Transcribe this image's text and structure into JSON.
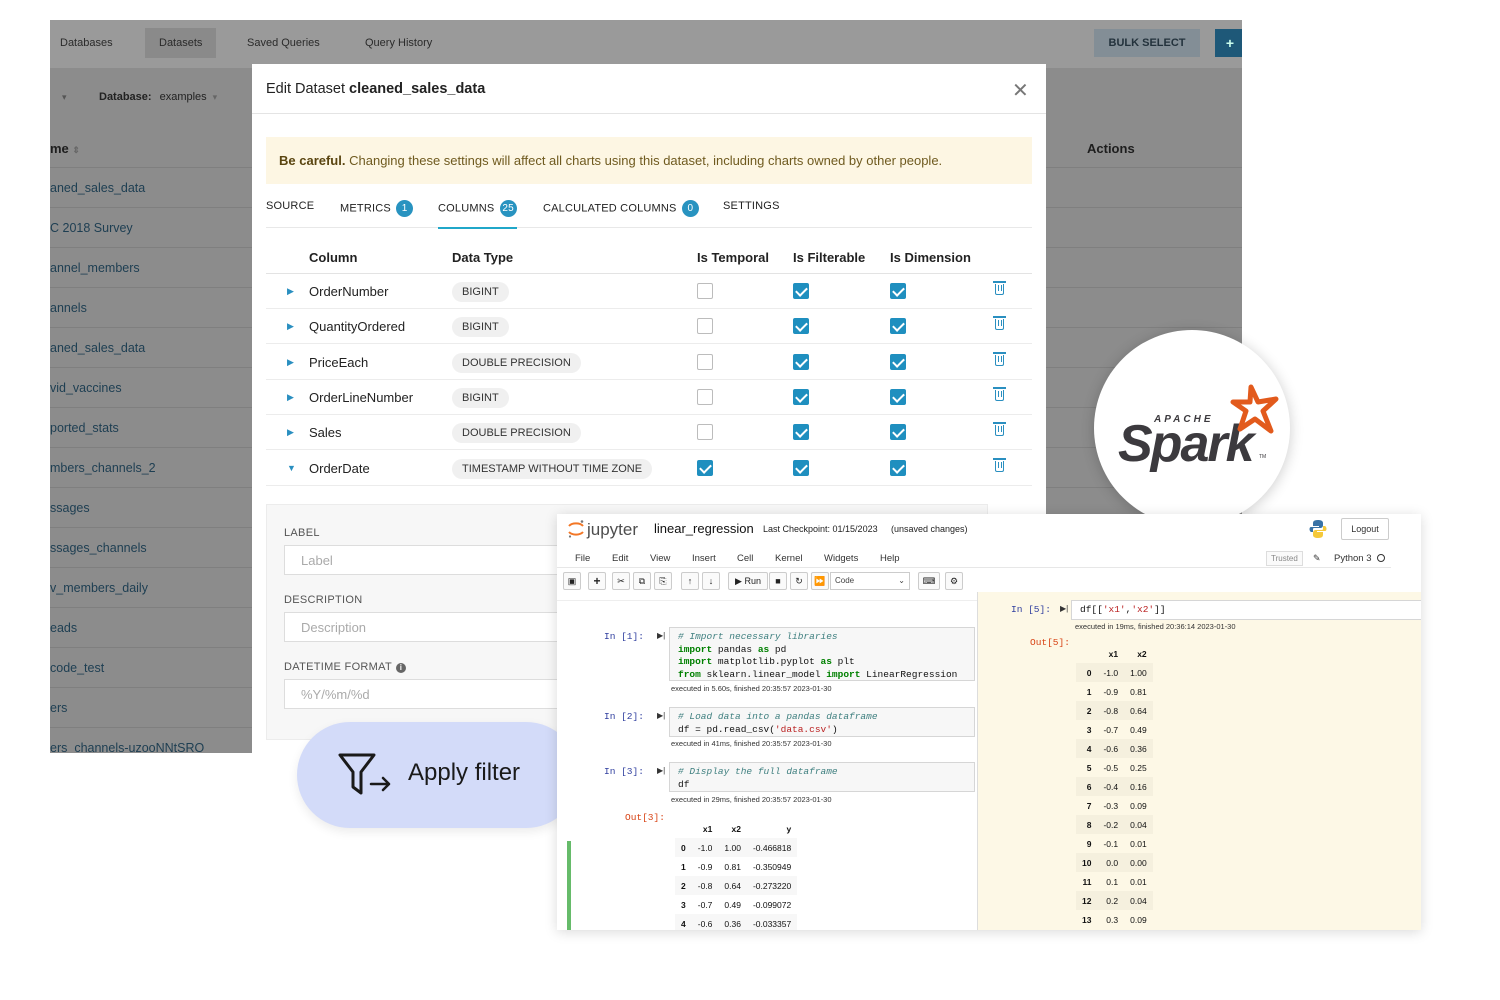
{
  "background_app": {
    "nav": [
      "Databases",
      "Datasets",
      "Saved Queries",
      "Query History"
    ],
    "bulk_select": "BULK SELECT",
    "add_button": "+",
    "database_filter_label": "Database:",
    "database_filter_value": "examples",
    "name_column": "me",
    "actions_column": "Actions",
    "rows": [
      "aned_sales_data",
      "C 2018 Survey",
      "annel_members",
      "annels",
      "aned_sales_data",
      "vid_vaccines",
      "ported_stats",
      "mbers_channels_2",
      "ssages",
      "ssages_channels",
      "v_members_daily",
      "eads",
      "code_test",
      "ers",
      "ers_channels-uzooNNtSRO"
    ]
  },
  "modal": {
    "title_prefix": "Edit Dataset",
    "title_dataset": "cleaned_sales_data",
    "warning_bold": "Be careful.",
    "warning_text": "Changing these settings will affect all charts using this dataset, including charts owned by other people.",
    "tabs": [
      {
        "label": "SOURCE",
        "count": null
      },
      {
        "label": "METRICS",
        "count": "1"
      },
      {
        "label": "COLUMNS",
        "count": "25"
      },
      {
        "label": "CALCULATED COLUMNS",
        "count": "0"
      },
      {
        "label": "SETTINGS",
        "count": null
      }
    ],
    "active_tab": "COLUMNS",
    "headers": [
      "Column",
      "Data Type",
      "Is Temporal",
      "Is Filterable",
      "Is Dimension"
    ],
    "columns": [
      {
        "name": "OrderNumber",
        "type": "BIGINT",
        "temporal": false,
        "filterable": true,
        "dimension": true,
        "expanded": false
      },
      {
        "name": "QuantityOrdered",
        "type": "BIGINT",
        "temporal": false,
        "filterable": true,
        "dimension": true,
        "expanded": false
      },
      {
        "name": "PriceEach",
        "type": "DOUBLE PRECISION",
        "temporal": false,
        "filterable": true,
        "dimension": true,
        "expanded": false
      },
      {
        "name": "OrderLineNumber",
        "type": "BIGINT",
        "temporal": false,
        "filterable": true,
        "dimension": true,
        "expanded": false
      },
      {
        "name": "Sales",
        "type": "DOUBLE PRECISION",
        "temporal": false,
        "filterable": true,
        "dimension": true,
        "expanded": false
      },
      {
        "name": "OrderDate",
        "type": "TIMESTAMP WITHOUT TIME ZONE",
        "temporal": true,
        "filterable": true,
        "dimension": true,
        "expanded": true
      }
    ],
    "form": {
      "label_title": "LABEL",
      "label_placeholder": "Label",
      "description_title": "DESCRIPTION",
      "description_placeholder": "Description",
      "datetime_title": "DATETIME FORMAT",
      "datetime_placeholder": "%Y/%m/%d"
    }
  },
  "apply_filter": {
    "label": "Apply filter"
  },
  "spark": {
    "apache": "APACHE",
    "word": "Spark",
    "tm": "TM"
  },
  "jupyter": {
    "logo": "jupyter",
    "notebook": "linear_regression",
    "checkpoint": "Last Checkpoint: 01/15/2023",
    "unsaved": "(unsaved changes)",
    "logout": "Logout",
    "menu": [
      "File",
      "Edit",
      "View",
      "Insert",
      "Cell",
      "Kernel",
      "Widgets",
      "Help"
    ],
    "trusted": "Trusted",
    "kernel": "Python 3",
    "run_label": "Run",
    "cell_type": "Code",
    "cells": [
      {
        "prompt": "In [1]:",
        "exec": "executed in 5.60s, finished 20:35:57 2023-01-30"
      },
      {
        "prompt": "In [2]:",
        "exec": "executed in 41ms, finished 20:35:57 2023-01-30"
      },
      {
        "prompt": "In [3]:",
        "exec": "executed in 29ms, finished 20:35:57 2023-01-30",
        "out": "Out[3]:"
      },
      {
        "prompt": "In [5]:",
        "exec": "executed in 19ms, finished 20:36:14 2023-01-30",
        "out": "Out[5]:"
      }
    ],
    "table3": {
      "headers": [
        "",
        "x1",
        "x2",
        "y"
      ],
      "rows": [
        [
          "0",
          "-1.0",
          "1.00",
          "-0.466818"
        ],
        [
          "1",
          "-0.9",
          "0.81",
          "-0.350949"
        ],
        [
          "2",
          "-0.8",
          "0.64",
          "-0.273220"
        ],
        [
          "3",
          "-0.7",
          "0.49",
          "-0.099072"
        ],
        [
          "4",
          "-0.6",
          "0.36",
          "-0.033357"
        ]
      ]
    },
    "table5": {
      "headers": [
        "",
        "x1",
        "x2"
      ],
      "rows": [
        [
          "0",
          "-1.0",
          "1.00"
        ],
        [
          "1",
          "-0.9",
          "0.81"
        ],
        [
          "2",
          "-0.8",
          "0.64"
        ],
        [
          "3",
          "-0.7",
          "0.49"
        ],
        [
          "4",
          "-0.6",
          "0.36"
        ],
        [
          "5",
          "-0.5",
          "0.25"
        ],
        [
          "6",
          "-0.4",
          "0.16"
        ],
        [
          "7",
          "-0.3",
          "0.09"
        ],
        [
          "8",
          "-0.2",
          "0.04"
        ],
        [
          "9",
          "-0.1",
          "0.01"
        ],
        [
          "10",
          "0.0",
          "0.00"
        ],
        [
          "11",
          "0.1",
          "0.01"
        ],
        [
          "12",
          "0.2",
          "0.04"
        ],
        [
          "13",
          "0.3",
          "0.09"
        ]
      ]
    }
  }
}
